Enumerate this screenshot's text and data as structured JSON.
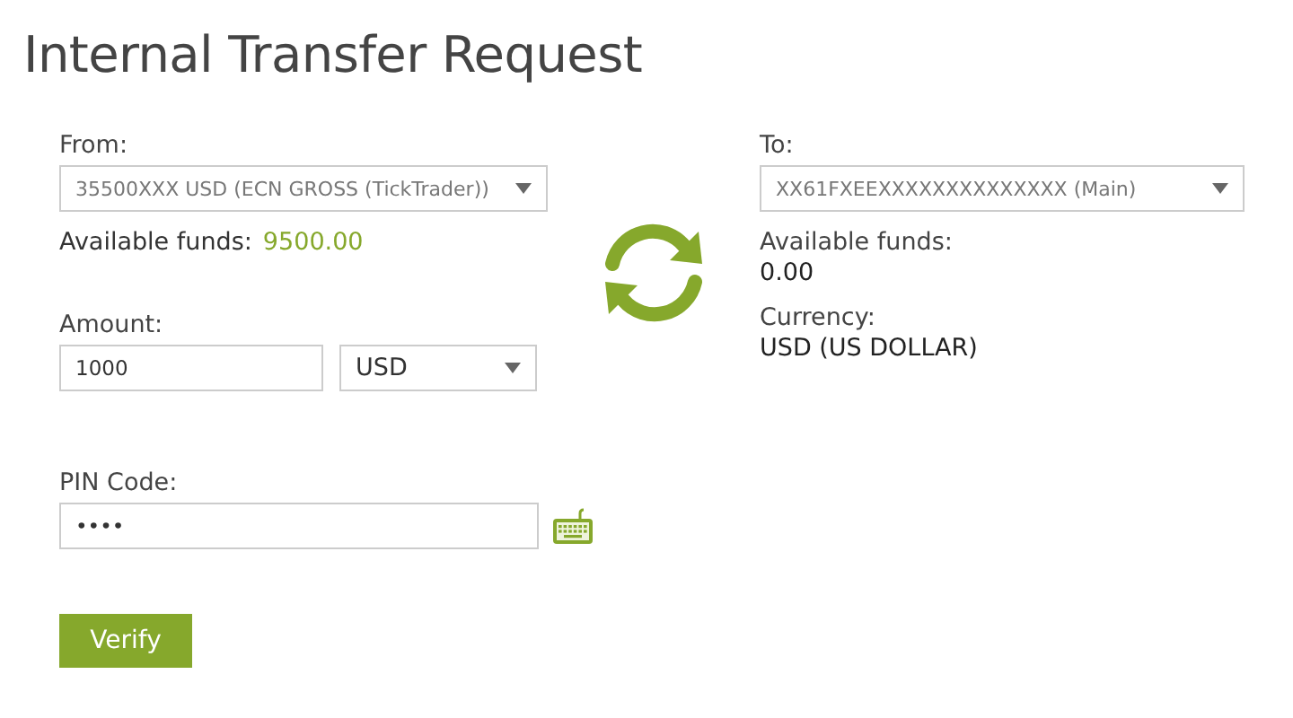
{
  "title": "Internal Transfer Request",
  "from": {
    "label": "From:",
    "account": "35500XXX USD (ECN GROSS (TickTrader))",
    "funds_label": "Available funds:",
    "funds": "9500.00"
  },
  "amount": {
    "label": "Amount:",
    "value": "1000",
    "currency": "USD"
  },
  "pin": {
    "label": "PIN Code:",
    "value": "••••"
  },
  "to": {
    "label": "To:",
    "account": "XX61FXEEXXXXXXXXXXXXXX (Main)",
    "funds_label": "Available funds:",
    "funds": "0.00",
    "currency_label": "Currency:",
    "currency": "USD (US DOLLAR)"
  },
  "button": "Verify"
}
